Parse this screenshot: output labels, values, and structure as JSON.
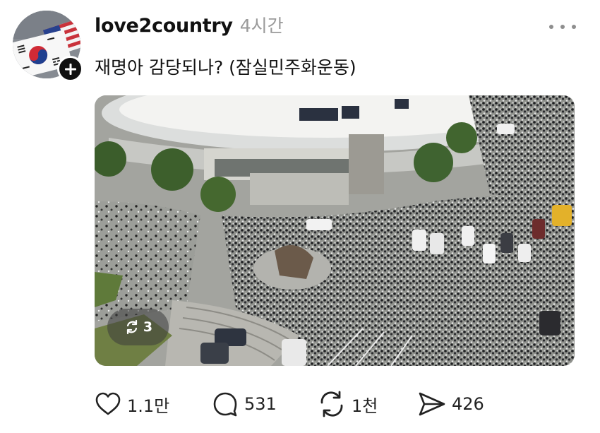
{
  "post": {
    "username": "love2country",
    "time": "4시간",
    "text": "재명아 감당되나? (잠실민주화운동)",
    "carousel_count": "3",
    "icons": {
      "avatar": "korea-usa-flags-avatar",
      "follow": "plus-icon",
      "more": "more-dots-icon",
      "carousel": "repost-arrows-icon"
    }
  },
  "actions": {
    "like_count": "1.1만",
    "comment_count": "531",
    "repost_count": "1천",
    "share_count": "426"
  },
  "colors": {
    "text": "#111111",
    "muted": "#9a9a9a",
    "badge": "#111111"
  }
}
